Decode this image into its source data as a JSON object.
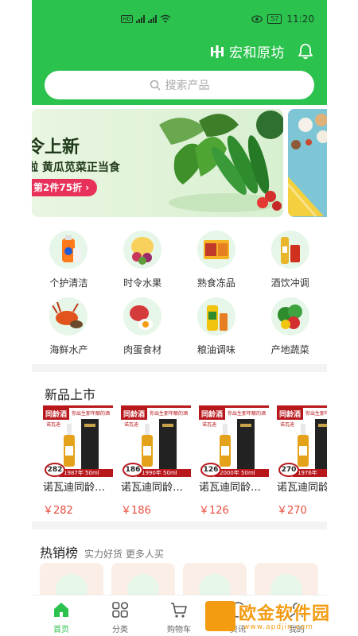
{
  "status_bar": {
    "time": "11:20",
    "battery": "57",
    "network_left": "HD",
    "network_right": "HD"
  },
  "header": {
    "brand_name": "宏和原坊"
  },
  "search": {
    "placeholder": "搜索产品"
  },
  "banner": {
    "title": "令上新",
    "subtitle": "啦 黄瓜苋菜正当食",
    "promo": "第2件75折 ›"
  },
  "categories": [
    {
      "label": "个护清洁",
      "icon": "detergent-icon"
    },
    {
      "label": "时令水果",
      "icon": "fruit-icon"
    },
    {
      "label": "熟食冻品",
      "icon": "deli-icon"
    },
    {
      "label": "酒饮冲调",
      "icon": "drinks-icon"
    },
    {
      "label": "海鲜水产",
      "icon": "seafood-icon"
    },
    {
      "label": "肉蛋食材",
      "icon": "meat-egg-icon"
    },
    {
      "label": "粮油调味",
      "icon": "grain-oil-icon"
    },
    {
      "label": "产地蔬菜",
      "icon": "vegetable-icon"
    }
  ],
  "new_products": {
    "title": "新品上市",
    "items": [
      {
        "tag": "同龄酒",
        "slogan": "你出生那年酿的酒",
        "brand": "诺瓦迪",
        "badge": "282",
        "strip": "1987年 50ml",
        "name": "诺瓦迪同龄…",
        "price": "￥282"
      },
      {
        "tag": "同龄酒",
        "slogan": "你出生那年酿的酒",
        "brand": "诺瓦迪",
        "badge": "186",
        "strip": "1990年 50ml",
        "name": "诺瓦迪同龄…",
        "price": "￥186"
      },
      {
        "tag": "同龄酒",
        "slogan": "你出生那年酿的酒",
        "brand": "诺瓦迪",
        "badge": "126",
        "strip": "2000年 50ml",
        "name": "诺瓦迪同龄…",
        "price": "￥126"
      },
      {
        "tag": "同龄酒",
        "slogan": "你出生那年酿的酒",
        "brand": "诺瓦迪",
        "badge": "270",
        "strip": "1976年",
        "name": "诺瓦迪同龄",
        "price": "￥270"
      }
    ]
  },
  "hot_sales": {
    "title": "热销榜",
    "subtitle": "实力好货 更多人买"
  },
  "tabbar": [
    {
      "label": "首页",
      "icon": "home-icon",
      "active": true
    },
    {
      "label": "分类",
      "icon": "category-icon",
      "active": false
    },
    {
      "label": "购物车",
      "icon": "cart-icon",
      "active": false
    },
    {
      "label": "资讯",
      "icon": "news-icon",
      "active": false
    },
    {
      "label": "我的",
      "icon": "profile-icon",
      "active": false
    }
  ],
  "watermark": {
    "text": "欧金软件园",
    "url": "www.apdjin.com"
  },
  "colors": {
    "primary": "#2cc24e",
    "price": "#e74c3c",
    "promo": "#e8315a",
    "wine_red": "#b8171c"
  }
}
